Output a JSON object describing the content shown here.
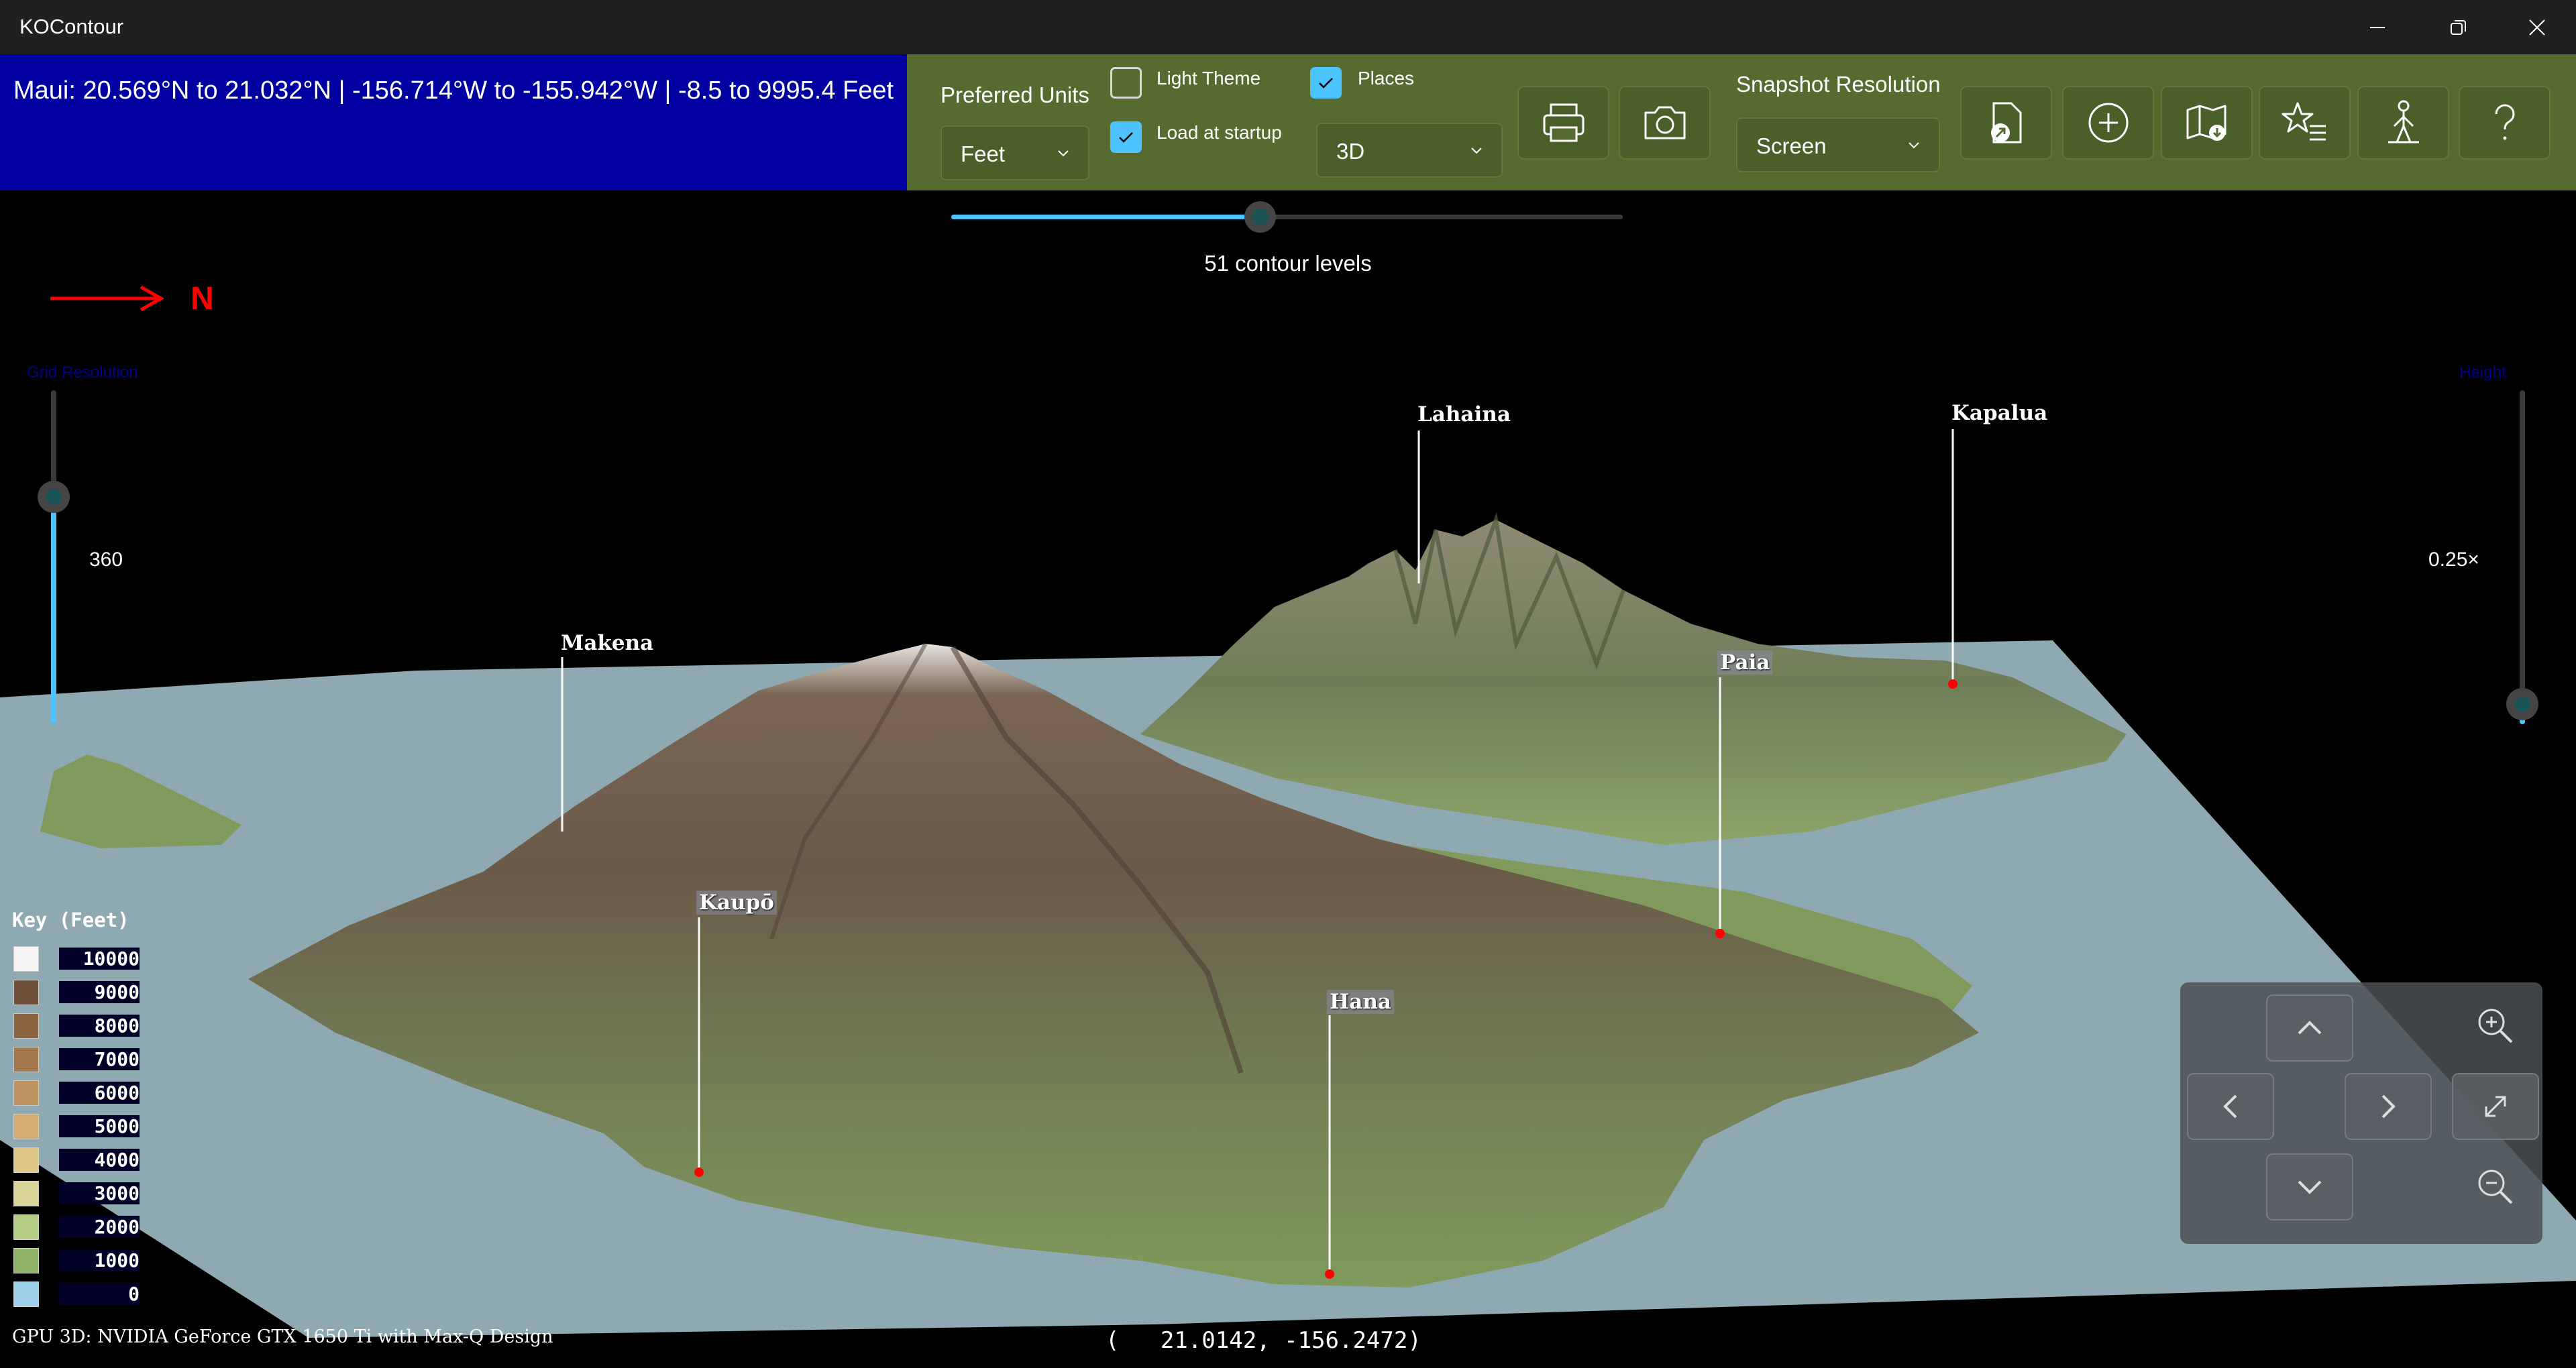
{
  "window": {
    "title": "KOContour",
    "controls": [
      "minimize-icon",
      "restore-icon",
      "close-icon"
    ]
  },
  "info": {
    "text": "Maui:  20.569°N to 21.032°N | -156.714°W to -155.942°W | -8.5 to 9995.4 Feet"
  },
  "toolbar": {
    "preferred_units_label": "Preferred Units",
    "preferred_units_value": "Feet",
    "light_theme_label": "Light Theme",
    "light_theme_checked": false,
    "load_at_startup_label": "Load at startup",
    "load_at_startup_checked": true,
    "places_label": "Places",
    "places_checked": true,
    "view_mode_value": "3D",
    "snapshot_resolution_label": "Snapshot Resolution",
    "snapshot_resolution_value": "Screen",
    "icons": [
      "print-icon",
      "camera-icon",
      "open-file-icon",
      "add-icon",
      "map-download-icon",
      "favorites-icon",
      "hiker-icon",
      "help-icon"
    ],
    "accent_color": "#556b2f",
    "checkbox_color": "#4cc2ff"
  },
  "contour": {
    "slider_fraction": 0.46,
    "label": "51 contour levels"
  },
  "compass": {
    "label": "N",
    "color": "#ff0000"
  },
  "grid_resolution": {
    "label": "Grid Resolution",
    "value": "360",
    "fraction": 0.68
  },
  "height": {
    "label": "Height",
    "value": "0.25×",
    "fraction": 0.06
  },
  "places": [
    {
      "name": "Lahaina",
      "boxed": false
    },
    {
      "name": "Kapalua",
      "boxed": false
    },
    {
      "name": "Makena",
      "boxed": false
    },
    {
      "name": "Paia",
      "boxed": true
    },
    {
      "name": "Kaupō",
      "boxed": true
    },
    {
      "name": "Hana",
      "boxed": true
    }
  ],
  "key": {
    "title": "Key (Feet)",
    "rows": [
      {
        "value": "10000",
        "color": "#f5f5f5"
      },
      {
        "value": "9000",
        "color": "#6e5038"
      },
      {
        "value": "8000",
        "color": "#8a6440"
      },
      {
        "value": "7000",
        "color": "#a4784c"
      },
      {
        "value": "6000",
        "color": "#bf9460"
      },
      {
        "value": "5000",
        "color": "#d4ae70"
      },
      {
        "value": "4000",
        "color": "#e0c888"
      },
      {
        "value": "3000",
        "color": "#d8d49a"
      },
      {
        "value": "2000",
        "color": "#b4cc84"
      },
      {
        "value": "1000",
        "color": "#8cb464"
      },
      {
        "value": "0",
        "color": "#9cd0e8"
      }
    ]
  },
  "gpu_text": "GPU 3D: NVIDIA GeForce GTX 1650 Ti with Max-Q Design",
  "coordinates": "(   21.0142, -156.2472)",
  "navigation": {
    "buttons": [
      "chevron-up-icon",
      "chevron-left-icon",
      "chevron-right-icon",
      "chevron-down-icon",
      "zoom-in-icon",
      "fit-view-icon",
      "zoom-out-icon"
    ]
  }
}
